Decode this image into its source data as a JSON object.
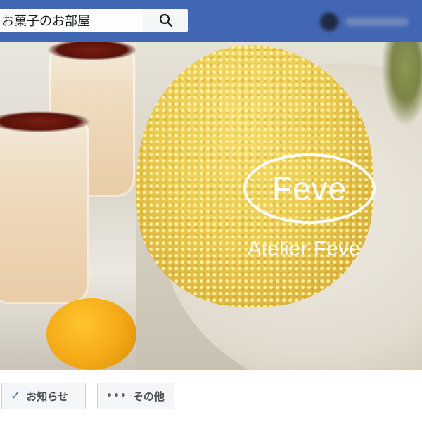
{
  "header": {
    "search": {
      "value": "お菓子のお部屋"
    },
    "icons": {
      "search": "search-icon",
      "profile": "blurred-profile"
    },
    "colors": {
      "bar": "#4267b2",
      "input": "#ffffff",
      "search_button": "#f5f6f7"
    }
  },
  "cover": {
    "logo_text": "Feve",
    "brand_name": "Atelier Feve"
  },
  "actions": {
    "notify_label": "お知らせ",
    "notify_icon": "check-icon",
    "more_label": "その他",
    "more_icon": "dots-icon"
  }
}
